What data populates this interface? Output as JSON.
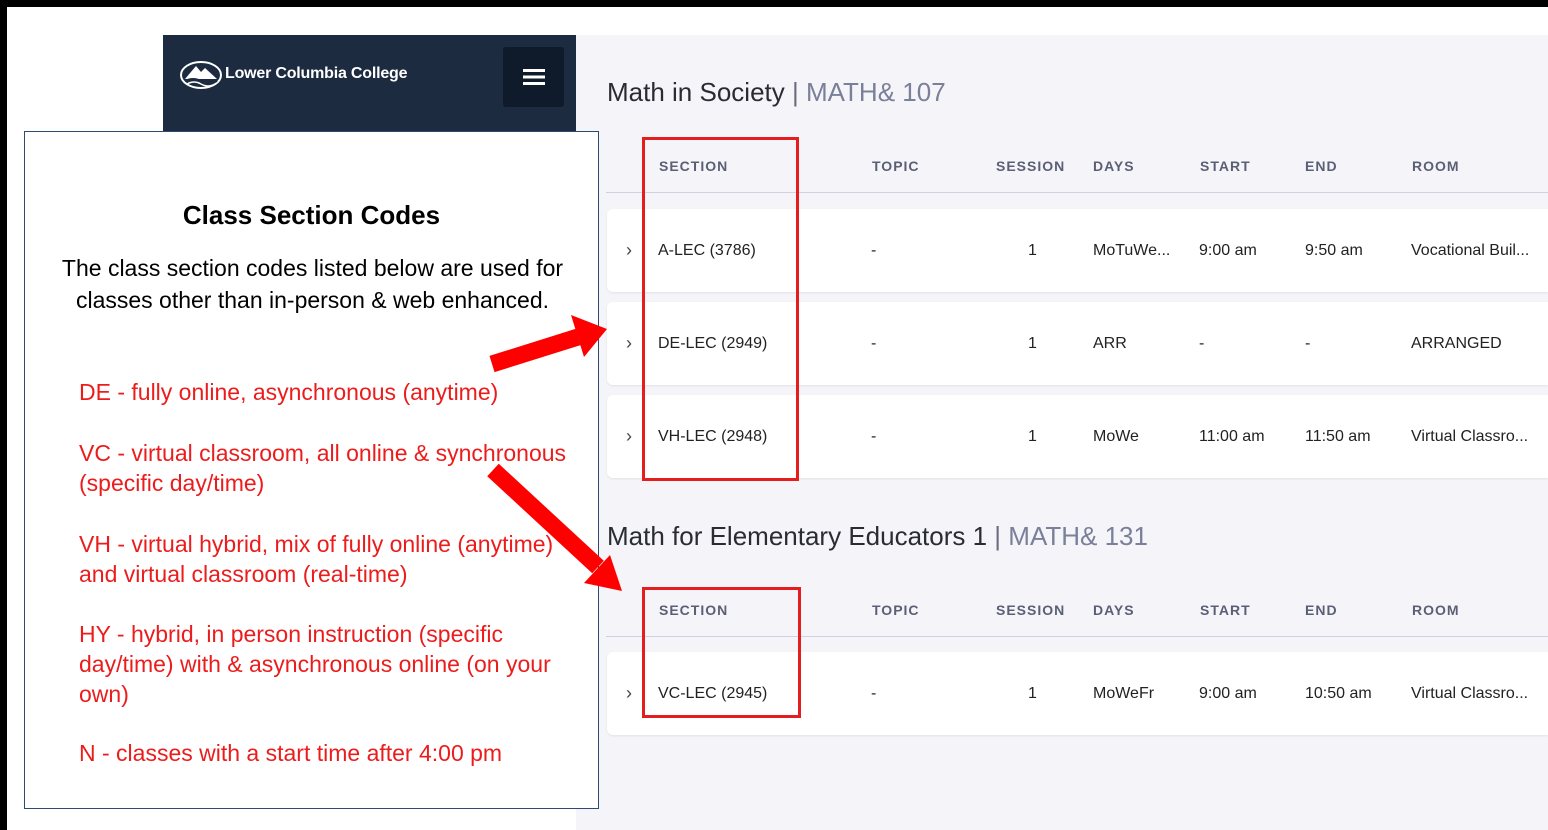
{
  "app": {
    "logo_text": "Lower Columbia College"
  },
  "courses": [
    {
      "title": "Math in Society",
      "separator": "|",
      "code": "MATH& 107",
      "columns": [
        "SECTION",
        "TOPIC",
        "SESSION",
        "DAYS",
        "START",
        "END",
        "ROOM"
      ],
      "rows": [
        {
          "section": "A-LEC (3786)",
          "topic": "-",
          "session": "1",
          "days": "MoTuWe...",
          "start": "9:00 am",
          "end": "9:50 am",
          "room": "Vocational Buil..."
        },
        {
          "section": "DE-LEC (2949)",
          "topic": "-",
          "session": "1",
          "days": "ARR",
          "start": "-",
          "end": "-",
          "room": "ARRANGED"
        },
        {
          "section": "VH-LEC (2948)",
          "topic": "-",
          "session": "1",
          "days": "MoWe",
          "start": "11:00 am",
          "end": "11:50 am",
          "room": "Virtual Classro..."
        }
      ]
    },
    {
      "title": "Math for Elementary Educators 1",
      "separator": "|",
      "code": "MATH& 131",
      "columns": [
        "SECTION",
        "TOPIC",
        "SESSION",
        "DAYS",
        "START",
        "END",
        "ROOM"
      ],
      "rows": [
        {
          "section": "VC-LEC (2945)",
          "topic": "-",
          "session": "1",
          "days": "MoWeFr",
          "start": "9:00 am",
          "end": "10:50 am",
          "room": "Virtual Classro..."
        }
      ]
    }
  ],
  "overlay": {
    "title": "Class Section Codes",
    "description": "The class section codes listed below are used for classes other than in-person & web enhanced.",
    "codes": [
      "DE - fully online, asynchronous (anytime)",
      "VC - virtual classroom, all online & synchronous (specific day/time)",
      "VH - virtual hybrid, mix of fully online (anytime) and virtual classroom (real-time)",
      "HY - hybrid, in person instruction (specific day/time) with & asynchronous online (on your own)",
      "N - classes with a start time after 4:00 pm"
    ]
  },
  "icons": {
    "menu": "hamburger-menu-icon",
    "expand": "chevron-right-icon",
    "logo": "mountain-logo-icon"
  },
  "colors": {
    "sidebar": "#1c2b3f",
    "annotation_red": "#e41e1e",
    "code_text": "#ec1c1c",
    "content_bg": "#f5f5f9"
  }
}
